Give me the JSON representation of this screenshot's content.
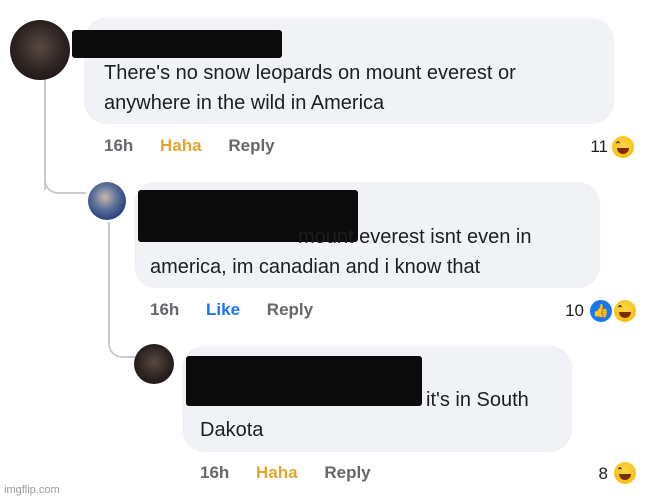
{
  "comments": [
    {
      "text_lines": [
        "There's no snow leopards on mount everest or",
        "anywhere in the wild in America"
      ],
      "time": "16h",
      "action": "Haha",
      "reply": "Reply",
      "reaction_count": "11",
      "reaction_icon": "haha-emoji-icon"
    },
    {
      "text_lines": [
        "mount everest isnt even in",
        "america, im canadian and i know that"
      ],
      "time": "16h",
      "action": "Like",
      "reply": "Reply",
      "reaction_count": "10",
      "reaction_icons": [
        "like-icon",
        "haha-emoji-icon"
      ]
    },
    {
      "text_lines": [
        "it's in South",
        "Dakota"
      ],
      "time": "16h",
      "action": "Haha",
      "reply": "Reply",
      "reaction_count": "8",
      "reaction_icon": "haha-emoji-icon"
    }
  ],
  "watermark": "imgflip.com",
  "colors": {
    "haha": "#e3a52e",
    "like": "#1877f2",
    "bubble": "#f0f2f5"
  }
}
